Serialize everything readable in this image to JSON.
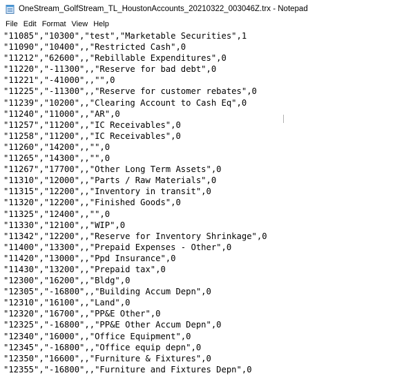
{
  "window": {
    "title": "OneStream_GolfStream_TL_HoustonAccounts_20210322_003046Z.trx - Notepad"
  },
  "menu": [
    "File",
    "Edit",
    "Format",
    "View",
    "Help"
  ],
  "lines": [
    "\"11085\",\"10300\",\"test\",\"Marketable Securities\",1",
    "\"11090\",\"10400\",,\"Restricted Cash\",0",
    "\"11212\",\"62600\",,\"Rebillable Expenditures\",0",
    "\"11220\",\"-11300\",,\"Reserve for bad debt\",0",
    "\"11221\",\"-41000\",,\"\",0",
    "\"11225\",\"-11300\",,\"Reserve for customer rebates\",0",
    "\"11239\",\"10200\",,\"Clearing Account to Cash Eq\",0",
    "\"11240\",\"11000\",,\"AR\",0",
    "\"11257\",\"11200\",,\"IC Receivables\",0",
    "\"11258\",\"11200\",,\"IC Receivables\",0",
    "\"11260\",\"14200\",,\"\",0",
    "\"11265\",\"14300\",,\"\",0",
    "\"11267\",\"17700\",,\"Other Long Term Assets\",0",
    "\"11310\",\"12000\",,\"Parts / Raw Materials\",0",
    "\"11315\",\"12200\",,\"Inventory in transit\",0",
    "\"11320\",\"12200\",,\"Finished Goods\",0",
    "\"11325\",\"12400\",,\"\",0",
    "\"11330\",\"12100\",,\"WIP\",0",
    "\"11342\",\"12200\",,\"Reserve for Inventory Shrinkage\",0",
    "\"11400\",\"13300\",,\"Prepaid Expenses - Other\",0",
    "\"11420\",\"13000\",,\"Ppd Insurance\",0",
    "\"11430\",\"13200\",,\"Prepaid tax\",0",
    "\"12300\",\"16200\",,\"Bldg\",0",
    "\"12305\",\"-16800\",,\"Building Accum Depn\",0",
    "\"12310\",\"16100\",,\"Land\",0",
    "\"12320\",\"16700\",,\"PP&E Other\",0",
    "\"12325\",\"-16800\",,\"PP&E Other Accum Depn\",0",
    "\"12340\",\"16000\",,\"Office Equipment\",0",
    "\"12345\",\"-16800\",,\"Office equip depn\",0",
    "\"12350\",\"16600\",,\"Furniture & Fixtures\",0",
    "\"12355\",\"-16800\",,\"Furniture and Fixtures Depn\",0"
  ]
}
